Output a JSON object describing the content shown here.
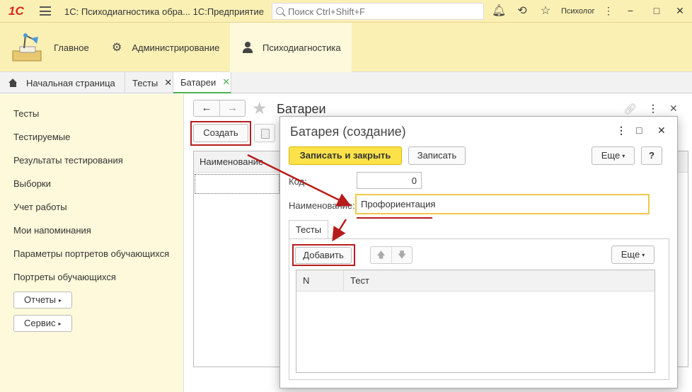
{
  "titlebar": {
    "logo": "1С",
    "app_title": "1С: Психодиагностика обра...  1С:Предприятие",
    "search_placeholder": "Поиск Ctrl+Shift+F",
    "user": "Психолог"
  },
  "sections": [
    {
      "label": "Главное",
      "icon": "desk-lamp-icon"
    },
    {
      "label": "Администрирование",
      "icon": "gear-icon"
    },
    {
      "label": "Психодиагностика",
      "icon": "person-icon"
    }
  ],
  "tabs": [
    {
      "label": "Начальная страница"
    },
    {
      "label": "Тесты"
    },
    {
      "label": "Батареи"
    }
  ],
  "nav": {
    "items": [
      "Тесты",
      "Тестируемые",
      "Результаты тестирования",
      "Выборки",
      "Учет работы",
      "Мои напоминания",
      "Параметры портретов обучающихся",
      "Портреты обучающихся"
    ],
    "buttons": [
      "Отчеты",
      "Сервис"
    ]
  },
  "list_form": {
    "title": "Батареи",
    "create_label": "Создать",
    "column_name": "Наименование"
  },
  "modal": {
    "title": "Батарея (создание)",
    "save_close_label": "Записать и закрыть",
    "save_label": "Записать",
    "more_label": "Еще",
    "help_label": "?",
    "code_label": "Код:",
    "code_value": "0",
    "name_label": "Наименование:",
    "name_value": "Профориентация",
    "tab_label": "Тесты",
    "add_label": "Добавить",
    "more2_label": "Еще",
    "col_n": "N",
    "col_test": "Тест"
  },
  "colors": {
    "accent_yellow": "#fbe24a",
    "panel_yellow": "#fef9db",
    "highlight_red": "#b71c1c",
    "active_tab": "#4caf50"
  }
}
